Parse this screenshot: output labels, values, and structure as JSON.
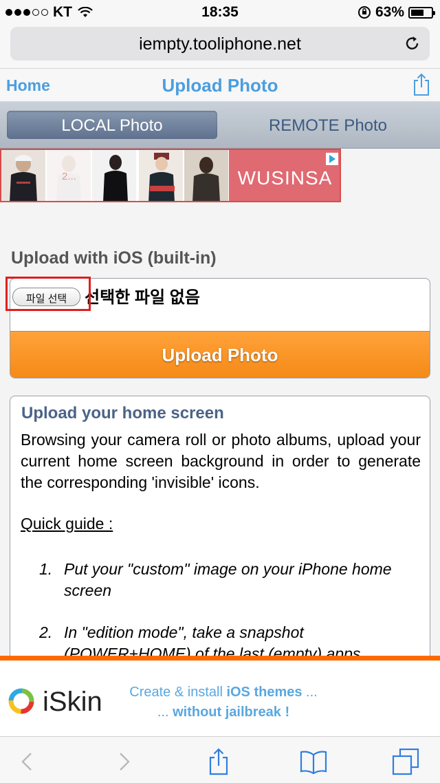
{
  "status_bar": {
    "carrier": "KT",
    "time": "18:35",
    "battery_text": "63%",
    "battery_level": 0.63,
    "signal_bars_filled": 3,
    "signal_bars_total": 5
  },
  "browser": {
    "url": "iempty.tooliphone.net",
    "icons": {
      "reload": "reload-icon",
      "share": "share-icon"
    }
  },
  "nav": {
    "home_label": "Home",
    "title": "Upload Photo",
    "share_icon": "share-icon"
  },
  "tabs": [
    {
      "label": "LOCAL Photo",
      "active": true
    },
    {
      "label": "REMOTE Photo",
      "active": false
    }
  ],
  "ad": {
    "brand": "WUSINSA",
    "thumb_label": "2...",
    "more_label": "•••"
  },
  "upload_section": {
    "title": "Upload with iOS (built-in)",
    "file_button_label": "파일 선택",
    "file_status": "선택한 파일 없음",
    "upload_button_label": "Upload Photo"
  },
  "info": {
    "title": "Upload your home screen",
    "body": "Browsing your camera roll or photo albums, upload your current home screen background in order to generate the corresponding 'invisible' icons.",
    "guide_label": "Quick guide :",
    "steps": [
      {
        "num": "1.",
        "text": "Put your \"custom\" image on your iPhone home screen"
      },
      {
        "num": "2.",
        "text": "In \"edition mode\", take a snapshot (POWER+HOME) of the last (empty) apps"
      }
    ]
  },
  "banner": {
    "name": "iSkin",
    "line1_pre": "Create & install ",
    "line1_bold": "iOS themes",
    "line1_post": " ...",
    "line2_pre": "... ",
    "line2_bold": "without jailbreak !"
  },
  "colors": {
    "link_blue": "#4a9ee0",
    "upload_orange": "#f58a17",
    "highlight_red": "#e01e1e",
    "banner_orange": "#ff6a00"
  },
  "toolbar": {
    "icons": [
      "back-icon",
      "forward-icon",
      "share-icon",
      "bookmarks-icon",
      "tabs-icon"
    ]
  }
}
